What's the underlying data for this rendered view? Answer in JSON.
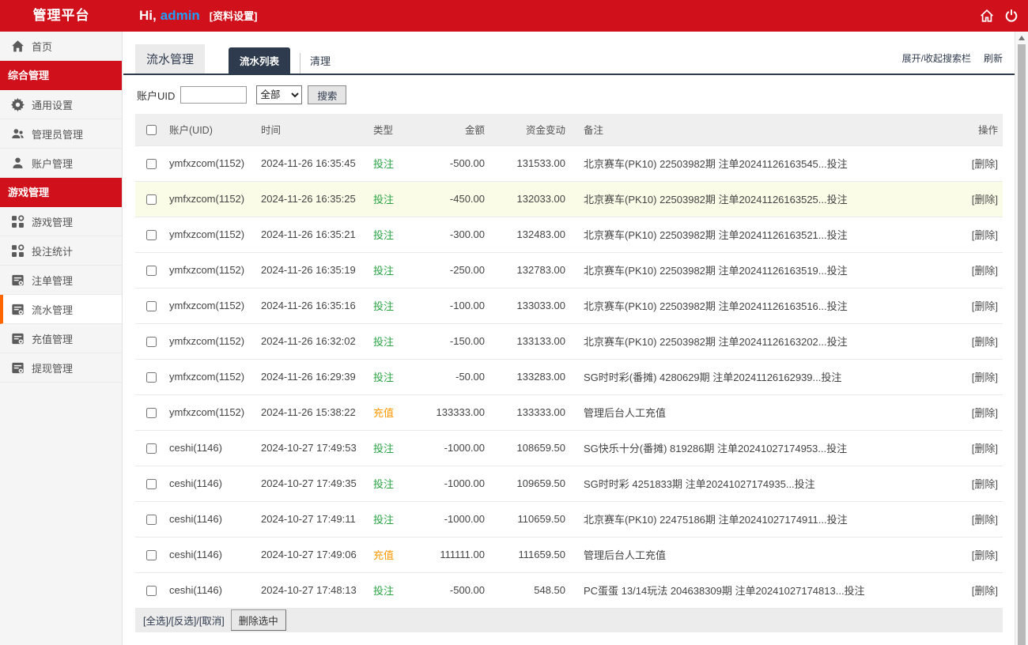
{
  "colors": {
    "brand_red": "#d0111b",
    "tab_navy": "#2e3a4d",
    "green": "#2aa344",
    "orange": "#ff9800",
    "row_highlight": "#fbfce8",
    "accent_orange": "#ff6600",
    "link_blue": "#1e9fff"
  },
  "header": {
    "brand": "管理平台",
    "greeting_prefix": "Hi,",
    "username": "admin",
    "profile_link": "[资料设置]",
    "icons": [
      "home-icon",
      "power-icon"
    ]
  },
  "sidebar": {
    "items": [
      {
        "type": "item",
        "key": "home",
        "label": "首页",
        "icon": "home-icon",
        "active": false
      },
      {
        "type": "section",
        "key": "general-group",
        "label": "综合管理"
      },
      {
        "type": "item",
        "key": "general-settings",
        "label": "通用设置",
        "icon": "gear-icon",
        "active": false
      },
      {
        "type": "item",
        "key": "admin-management",
        "label": "管理员管理",
        "icon": "admins-icon",
        "active": false
      },
      {
        "type": "item",
        "key": "account-management",
        "label": "账户管理",
        "icon": "user-icon",
        "active": false
      },
      {
        "type": "section",
        "key": "game-group",
        "label": "游戏管理"
      },
      {
        "type": "item",
        "key": "game-management",
        "label": "游戏管理",
        "icon": "grid-icon",
        "active": false
      },
      {
        "type": "item",
        "key": "bet-stats",
        "label": "投注统计",
        "icon": "grid-icon",
        "active": false
      },
      {
        "type": "item",
        "key": "order-management",
        "label": "注单管理",
        "icon": "form-icon",
        "active": false
      },
      {
        "type": "item",
        "key": "flow-management",
        "label": "流水管理",
        "icon": "form-icon",
        "active": true
      },
      {
        "type": "item",
        "key": "recharge-management",
        "label": "充值管理",
        "icon": "form-icon",
        "active": false
      },
      {
        "type": "item",
        "key": "withdraw-management",
        "label": "提现管理",
        "icon": "form-icon",
        "active": false
      }
    ]
  },
  "main": {
    "title": "流水管理",
    "tabs": [
      {
        "label": "流水列表",
        "active": true
      },
      {
        "label": "清理",
        "active": false
      }
    ],
    "toolbar_links": [
      {
        "label": "展开/收起搜索栏"
      },
      {
        "label": "刷新"
      }
    ],
    "search": {
      "label": "账户UID",
      "input_value": "",
      "select_value": "全部",
      "button_label": "搜索"
    },
    "table": {
      "headers": [
        {
          "key": "account",
          "label": "账户(UID)",
          "align": "left"
        },
        {
          "key": "time",
          "label": "时间",
          "align": "left"
        },
        {
          "key": "type",
          "label": "类型",
          "align": "left"
        },
        {
          "key": "amount",
          "label": "金额",
          "align": "right"
        },
        {
          "key": "balance",
          "label": "资金变动",
          "align": "right"
        },
        {
          "key": "remark",
          "label": "备注",
          "align": "left"
        },
        {
          "key": "action",
          "label": "操作",
          "align": "right"
        }
      ],
      "rows": [
        {
          "account": "ymfxzcom(1152)",
          "time": "2024-11-26 16:35:45",
          "type": "投注",
          "type_color": "green",
          "amount": "-500.00",
          "balance": "131533.00",
          "remark": "北京赛车(PK10) 22503982期 注单20241126163545...投注",
          "action": "[删除]",
          "highlighted": false
        },
        {
          "account": "ymfxzcom(1152)",
          "time": "2024-11-26 16:35:25",
          "type": "投注",
          "type_color": "green",
          "amount": "-450.00",
          "balance": "132033.00",
          "remark": "北京赛车(PK10) 22503982期 注单20241126163525...投注",
          "action": "[删除]",
          "highlighted": true
        },
        {
          "account": "ymfxzcom(1152)",
          "time": "2024-11-26 16:35:21",
          "type": "投注",
          "type_color": "green",
          "amount": "-300.00",
          "balance": "132483.00",
          "remark": "北京赛车(PK10) 22503982期 注单20241126163521...投注",
          "action": "[删除]",
          "highlighted": false
        },
        {
          "account": "ymfxzcom(1152)",
          "time": "2024-11-26 16:35:19",
          "type": "投注",
          "type_color": "green",
          "amount": "-250.00",
          "balance": "132783.00",
          "remark": "北京赛车(PK10) 22503982期 注单20241126163519...投注",
          "action": "[删除]",
          "highlighted": false
        },
        {
          "account": "ymfxzcom(1152)",
          "time": "2024-11-26 16:35:16",
          "type": "投注",
          "type_color": "green",
          "amount": "-100.00",
          "balance": "133033.00",
          "remark": "北京赛车(PK10) 22503982期 注单20241126163516...投注",
          "action": "[删除]",
          "highlighted": false
        },
        {
          "account": "ymfxzcom(1152)",
          "time": "2024-11-26 16:32:02",
          "type": "投注",
          "type_color": "green",
          "amount": "-150.00",
          "balance": "133133.00",
          "remark": "北京赛车(PK10) 22503982期 注单20241126163202...投注",
          "action": "[删除]",
          "highlighted": false
        },
        {
          "account": "ymfxzcom(1152)",
          "time": "2024-11-26 16:29:39",
          "type": "投注",
          "type_color": "green",
          "amount": "-50.00",
          "balance": "133283.00",
          "remark": "SG时时彩(番摊) 4280629期 注单20241126162939...投注",
          "action": "[删除]",
          "highlighted": false
        },
        {
          "account": "ymfxzcom(1152)",
          "time": "2024-11-26 15:38:22",
          "type": "充值",
          "type_color": "orange",
          "amount": "133333.00",
          "balance": "133333.00",
          "remark": "管理后台人工充值",
          "action": "[删除]",
          "highlighted": false
        },
        {
          "account": "ceshi(1146)",
          "time": "2024-10-27 17:49:53",
          "type": "投注",
          "type_color": "green",
          "amount": "-1000.00",
          "balance": "108659.50",
          "remark": "SG快乐十分(番摊) 819286期 注单20241027174953...投注",
          "action": "[删除]",
          "highlighted": false
        },
        {
          "account": "ceshi(1146)",
          "time": "2024-10-27 17:49:35",
          "type": "投注",
          "type_color": "green",
          "amount": "-1000.00",
          "balance": "109659.50",
          "remark": "SG时时彩 4251833期 注单20241027174935...投注",
          "action": "[删除]",
          "highlighted": false
        },
        {
          "account": "ceshi(1146)",
          "time": "2024-10-27 17:49:11",
          "type": "投注",
          "type_color": "green",
          "amount": "-1000.00",
          "balance": "110659.50",
          "remark": "北京赛车(PK10) 22475186期 注单20241027174911...投注",
          "action": "[删除]",
          "highlighted": false
        },
        {
          "account": "ceshi(1146)",
          "time": "2024-10-27 17:49:06",
          "type": "充值",
          "type_color": "orange",
          "amount": "111111.00",
          "balance": "111659.50",
          "remark": "管理后台人工充值",
          "action": "[删除]",
          "highlighted": false
        },
        {
          "account": "ceshi(1146)",
          "time": "2024-10-27 17:48:13",
          "type": "投注",
          "type_color": "green",
          "amount": "-500.00",
          "balance": "548.50",
          "remark": "PC蛋蛋 13/14玩法 204638309期 注单20241027174813...投注",
          "action": "[删除]",
          "highlighted": false
        }
      ]
    },
    "footer": {
      "select_links": "[全选]/[反选]/[取消]",
      "delete_button": "删除选中"
    }
  }
}
